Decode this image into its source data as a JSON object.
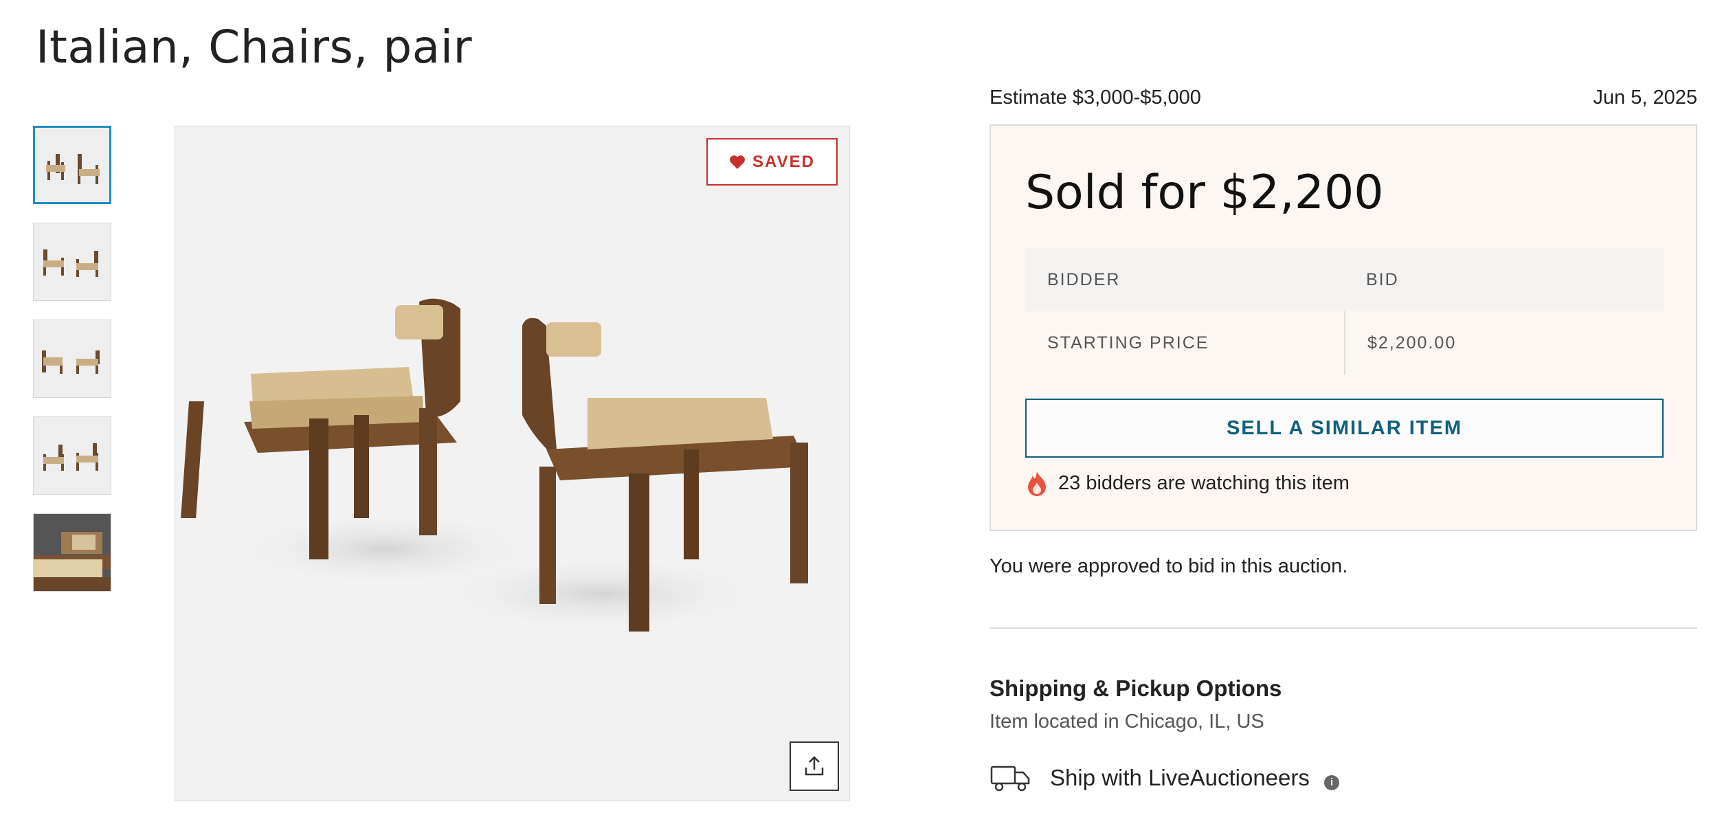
{
  "lot": {
    "title": "Italian, Chairs, pair"
  },
  "gallery": {
    "saved_label": "SAVED",
    "thumbnail_count": 5
  },
  "summary": {
    "estimate": "Estimate $3,000-$5,000",
    "date": "Jun 5, 2025",
    "sold_for": "Sold for $2,200"
  },
  "bid_table": {
    "headers": [
      "BIDDER",
      "BID"
    ],
    "rows": [
      {
        "bidder": "STARTING PRICE",
        "bid": "$2,200.00"
      }
    ]
  },
  "actions": {
    "sell_similar_label": "SELL A SIMILAR ITEM"
  },
  "watching": {
    "text": "23 bidders are watching this item"
  },
  "approval": {
    "text": "You were approved to bid in this auction."
  },
  "shipping": {
    "title": "Shipping & Pickup Options",
    "location": "Item located in Chicago, IL, US",
    "method": "Ship with LiveAuctioneers"
  },
  "colors": {
    "saved_red": "#c9302c",
    "accent_teal": "#10607e",
    "thumb_active_border": "#1e8ec3",
    "sold_box_bg": "#fcf7f3"
  },
  "icons": {
    "saved": "heart-icon",
    "share": "share-icon",
    "watching": "flame-icon",
    "shipping": "truck-icon",
    "info": "info-icon"
  }
}
